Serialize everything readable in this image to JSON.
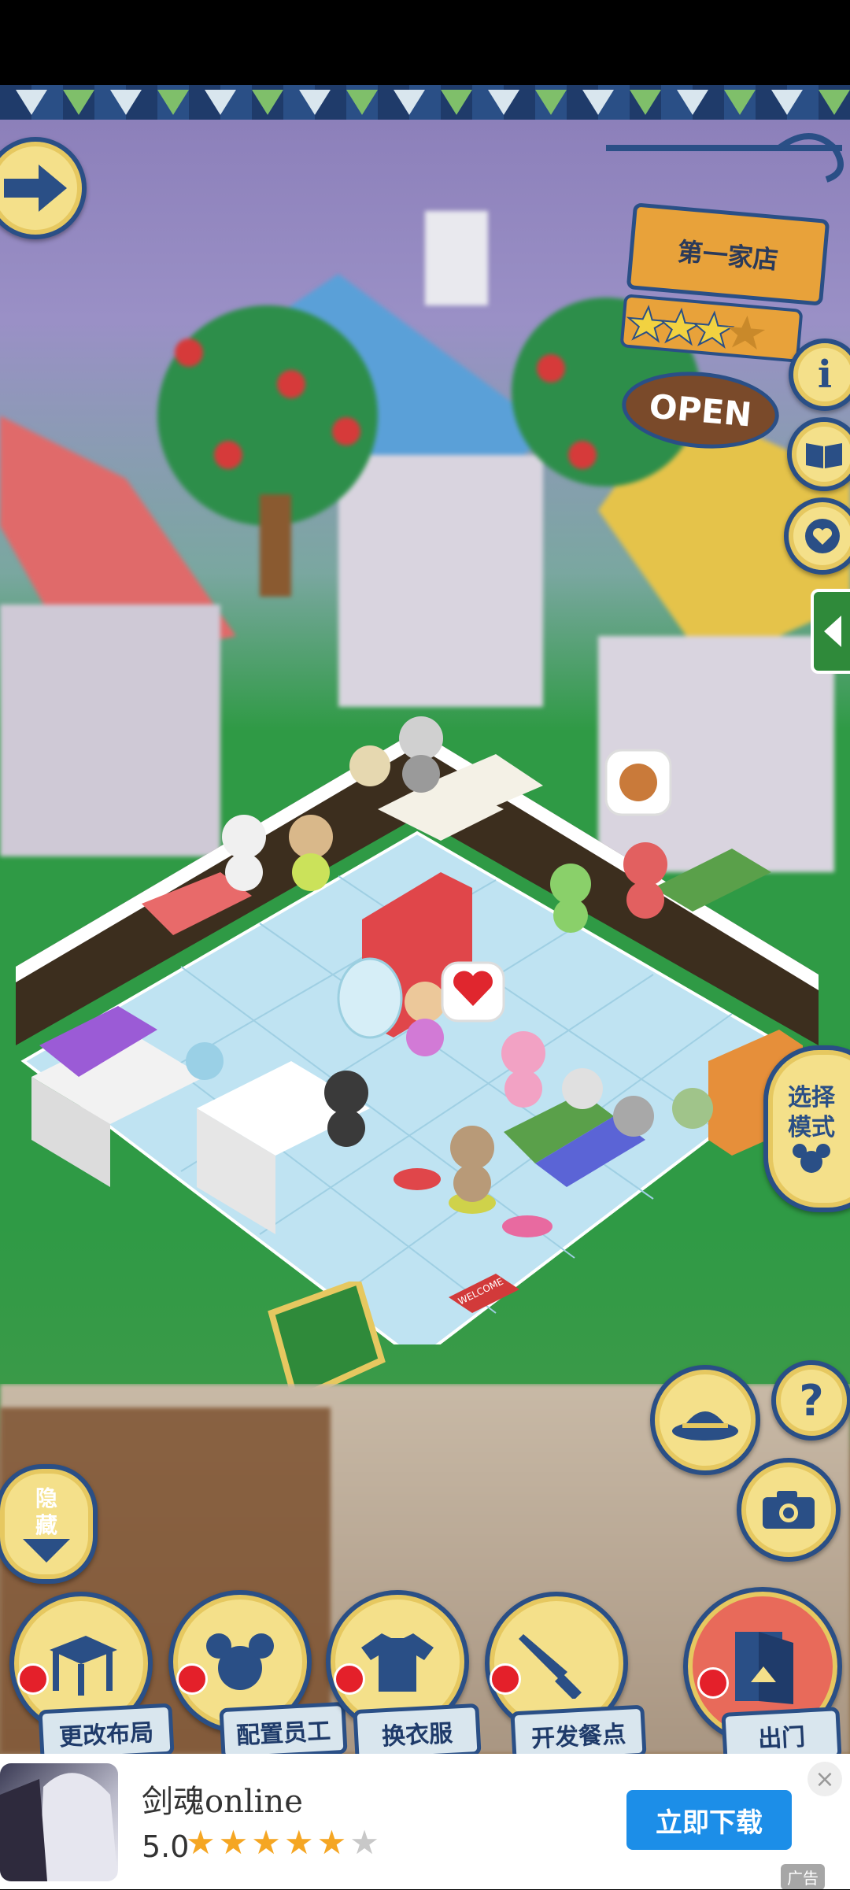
{
  "store": {
    "name": "第一家店",
    "rating_stars": 3.5,
    "status": "OPEN"
  },
  "side_buttons": {
    "info_icon": "info-icon",
    "menu_icon": "menu-book-icon",
    "favorite_icon": "heart-bubble-icon"
  },
  "mode": {
    "label": "选择模式"
  },
  "hide": {
    "label": "隐藏"
  },
  "actions": [
    {
      "label": "更改布局"
    },
    {
      "label": "配置员工"
    },
    {
      "label": "换衣服"
    },
    {
      "label": "开发餐点"
    },
    {
      "label": "出门"
    }
  ],
  "restaurant": {
    "welcome_mat": "WELCOME"
  },
  "ad": {
    "title": "剑魂online",
    "rating": "5.0",
    "stars_filled": 5,
    "stars_total": 6,
    "download_label": "立即下载",
    "close_label": "×",
    "ad_tag": "广告"
  },
  "colors": {
    "navy": "#2a4f86",
    "badge_yellow": "#f4e08a",
    "ad_button": "#1c8ee8"
  }
}
